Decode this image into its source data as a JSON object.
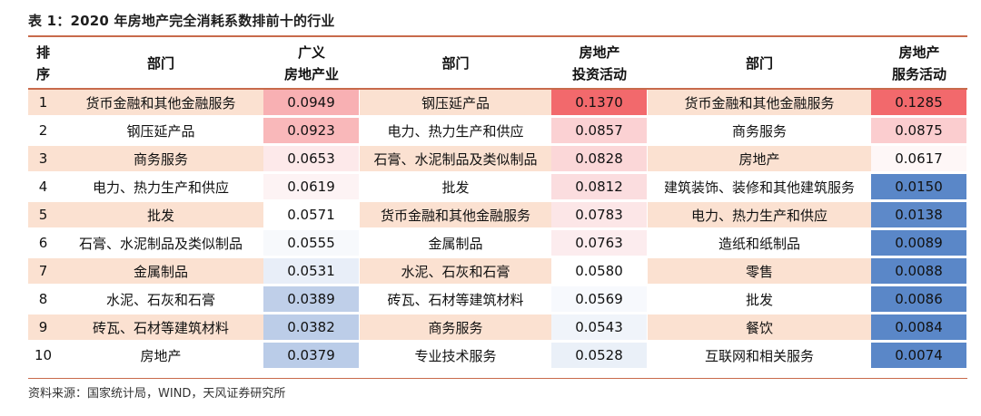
{
  "title": "表 1：2020 年房地产完全消耗系数排前十的行业",
  "headers": {
    "rank": "排\n序",
    "dept1": "部门",
    "col1": "广义\n房地产业",
    "dept2": "部门",
    "col2": "房地产\n投资活动",
    "dept3": "部门",
    "col3": "房地产\n服务活动"
  },
  "rows": [
    {
      "rank": "1",
      "d1": "货币金融和其他金融服务",
      "v1": "0.0949",
      "d2": "钢压延产品",
      "v2": "0.1370",
      "d3": "货币金融和其他金融服务",
      "v3": "0.1285"
    },
    {
      "rank": "2",
      "d1": "钢压延产品",
      "v1": "0.0923",
      "d2": "电力、热力生产和供应",
      "v2": "0.0857",
      "d3": "商务服务",
      "v3": "0.0875"
    },
    {
      "rank": "3",
      "d1": "商务服务",
      "v1": "0.0653",
      "d2": "石膏、水泥制品及类似制品",
      "v2": "0.0828",
      "d3": "房地产",
      "v3": "0.0617"
    },
    {
      "rank": "4",
      "d1": "电力、热力生产和供应",
      "v1": "0.0619",
      "d2": "批发",
      "v2": "0.0812",
      "d3": "建筑装饰、装修和其他建筑服务",
      "v3": "0.0150"
    },
    {
      "rank": "5",
      "d1": "批发",
      "v1": "0.0571",
      "d2": "货币金融和其他金融服务",
      "v2": "0.0783",
      "d3": "电力、热力生产和供应",
      "v3": "0.0138"
    },
    {
      "rank": "6",
      "d1": "石膏、水泥制品及类似制品",
      "v1": "0.0555",
      "d2": "金属制品",
      "v2": "0.0763",
      "d3": "造纸和纸制品",
      "v3": "0.0089"
    },
    {
      "rank": "7",
      "d1": "金属制品",
      "v1": "0.0531",
      "d2": "水泥、石灰和石膏",
      "v2": "0.0580",
      "d3": "零售",
      "v3": "0.0088"
    },
    {
      "rank": "8",
      "d1": "水泥、石灰和石膏",
      "v1": "0.0389",
      "d2": "砖瓦、石材等建筑材料",
      "v2": "0.0569",
      "d3": "批发",
      "v3": "0.0086"
    },
    {
      "rank": "9",
      "d1": "砖瓦、石材等建筑材料",
      "v1": "0.0382",
      "d2": "商务服务",
      "v2": "0.0543",
      "d3": "餐饮",
      "v3": "0.0084"
    },
    {
      "rank": "10",
      "d1": "房地产",
      "v1": "0.0379",
      "d2": "专业技术服务",
      "v2": "0.0528",
      "d3": "互联网和相关服务",
      "v3": "0.0074"
    }
  ],
  "heat_colors": {
    "v1": [
      "#f8b0b3",
      "#f9b8ba",
      "#fde9ea",
      "#fdf3f4",
      "#ffffff",
      "#f7f9fc",
      "#e8eef8",
      "#bfcfe9",
      "#bccde8",
      "#bacce8"
    ],
    "v2": [
      "#f2696c",
      "#fbd1d3",
      "#fbd7d8",
      "#fbdddf",
      "#fce6e7",
      "#fcecee",
      "#ffffff",
      "#f7f9fd",
      "#f0f4fa",
      "#eaf0f8"
    ],
    "v3": [
      "#f2696c",
      "#fbcdcf",
      "#fef7f7",
      "#5a87c8",
      "#5d89c9",
      "#5a87c8",
      "#5a87c8",
      "#5a87c8",
      "#5a87c8",
      "#5a87c8"
    ]
  },
  "source_note": "资料来源：国家统计局，WIND，天风证券研究所"
}
